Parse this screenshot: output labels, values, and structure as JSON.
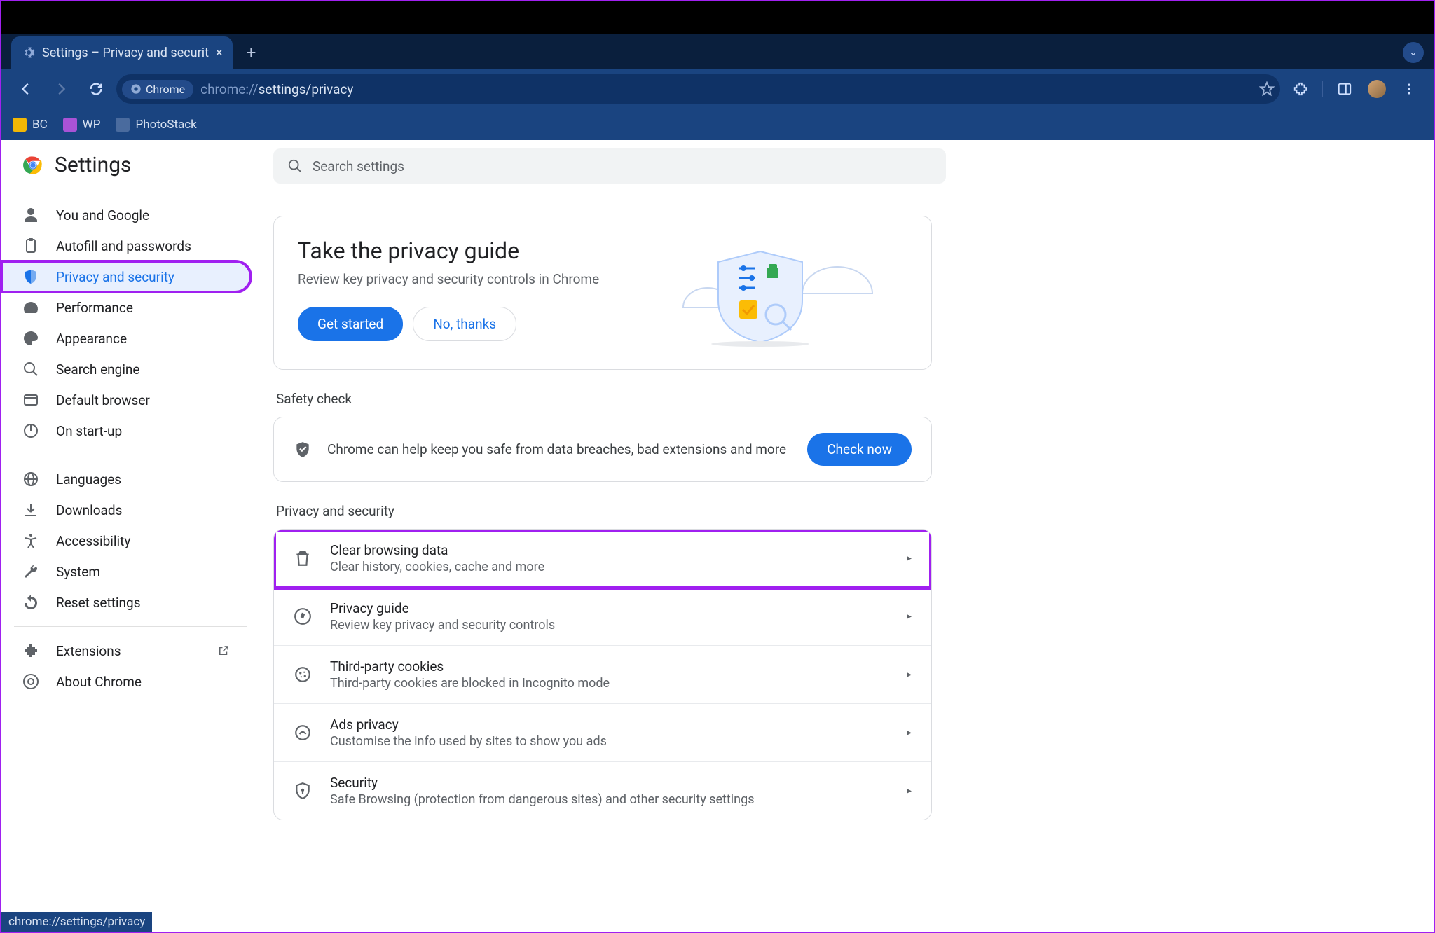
{
  "tab": {
    "title": "Settings – Privacy and securit"
  },
  "omnibox": {
    "chip": "Chrome",
    "path_dim": "chrome://",
    "path_bold": "settings/privacy"
  },
  "bookmarks": [
    {
      "label": "BC",
      "color": "#f2b705"
    },
    {
      "label": "WP",
      "color": "#a953d6"
    },
    {
      "label": "PhotoStack",
      "color": "#4a6b9e"
    }
  ],
  "sidebar": {
    "title": "Settings",
    "groups": [
      [
        {
          "label": "You and Google",
          "icon": "person"
        },
        {
          "label": "Autofill and passwords",
          "icon": "clipboard"
        },
        {
          "label": "Privacy and security",
          "icon": "shield",
          "active": true
        },
        {
          "label": "Performance",
          "icon": "speed"
        },
        {
          "label": "Appearance",
          "icon": "palette"
        },
        {
          "label": "Search engine",
          "icon": "search"
        },
        {
          "label": "Default browser",
          "icon": "window"
        },
        {
          "label": "On start-up",
          "icon": "power"
        }
      ],
      [
        {
          "label": "Languages",
          "icon": "globe"
        },
        {
          "label": "Downloads",
          "icon": "download"
        },
        {
          "label": "Accessibility",
          "icon": "accessibility"
        },
        {
          "label": "System",
          "icon": "wrench"
        },
        {
          "label": "Reset settings",
          "icon": "restore"
        }
      ],
      [
        {
          "label": "Extensions",
          "icon": "extension",
          "external": true
        },
        {
          "label": "About Chrome",
          "icon": "chrome"
        }
      ]
    ]
  },
  "search": {
    "placeholder": "Search settings"
  },
  "privacy_guide": {
    "title": "Take the privacy guide",
    "subtitle": "Review key privacy and security controls in Chrome",
    "primary": "Get started",
    "secondary": "No, thanks"
  },
  "safety": {
    "label": "Safety check",
    "text": "Chrome can help keep you safe from data breaches, bad extensions and more",
    "button": "Check now"
  },
  "privacy_section": {
    "label": "Privacy and security",
    "rows": [
      {
        "title": "Clear browsing data",
        "sub": "Clear history, cookies, cache and more",
        "icon": "trash",
        "hl": true
      },
      {
        "title": "Privacy guide",
        "sub": "Review key privacy and security controls",
        "icon": "compass"
      },
      {
        "title": "Third-party cookies",
        "sub": "Third-party cookies are blocked in Incognito mode",
        "icon": "cookie"
      },
      {
        "title": "Ads privacy",
        "sub": "Customise the info used by sites to show you ads",
        "icon": "ads"
      },
      {
        "title": "Security",
        "sub": "Safe Browsing (protection from dangerous sites) and other security settings",
        "icon": "security"
      }
    ]
  },
  "status": "chrome://settings/privacy"
}
